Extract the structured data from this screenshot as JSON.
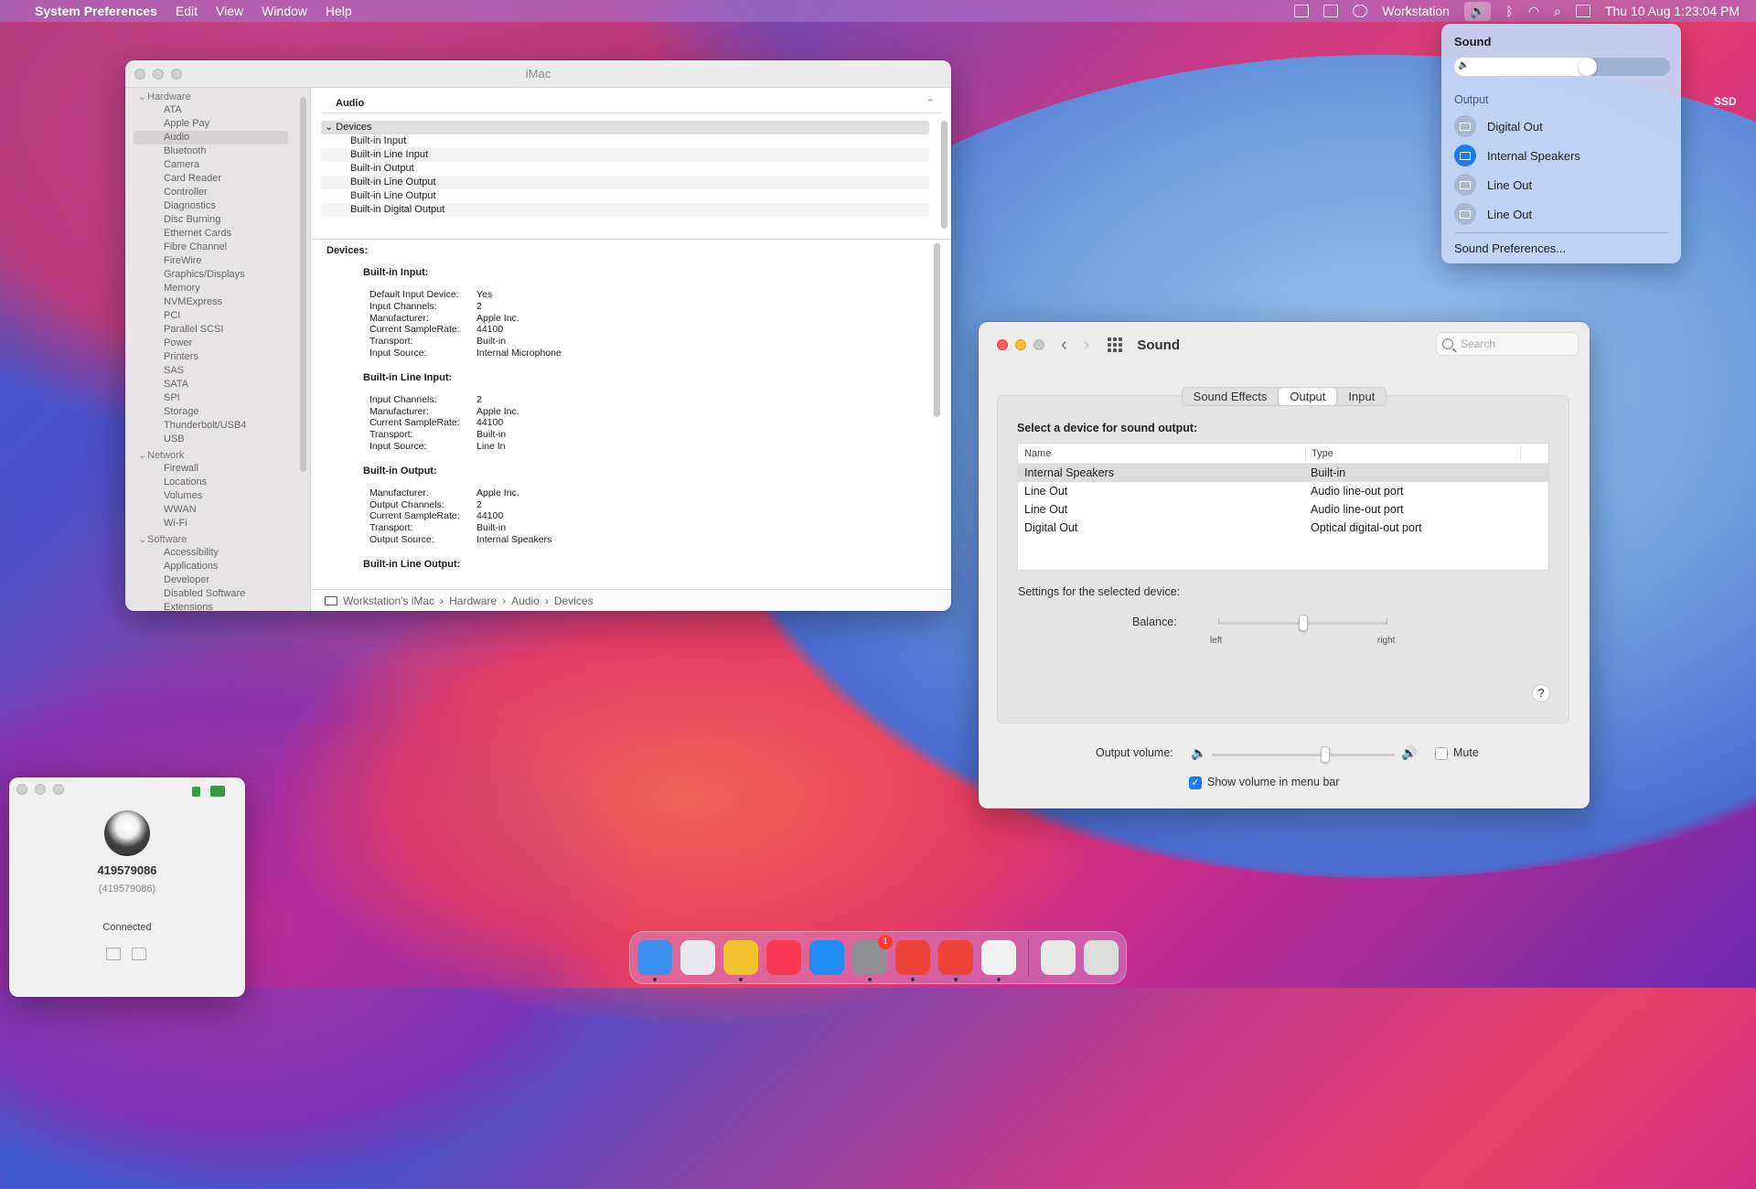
{
  "menubar": {
    "app_name": "System Preferences",
    "menus": [
      "Edit",
      "View",
      "Window",
      "Help"
    ],
    "user": "Workstation",
    "clock": "Thu 10 Aug  1:23:04 PM"
  },
  "desktop": {
    "disk_label": "SSD"
  },
  "sysinfo": {
    "title": "iMac",
    "sidebar": {
      "groups": [
        {
          "label": "Hardware",
          "items": [
            "ATA",
            "Apple Pay",
            "Audio",
            "Bluetooth",
            "Camera",
            "Card Reader",
            "Controller",
            "Diagnostics",
            "Disc Burning",
            "Ethernet Cards",
            "Fibre Channel",
            "FireWire",
            "Graphics/Displays",
            "Memory",
            "NVMExpress",
            "PCI",
            "Parallel SCSI",
            "Power",
            "Printers",
            "SAS",
            "SATA",
            "SPI",
            "Storage",
            "Thunderbolt/USB4",
            "USB"
          ]
        },
        {
          "label": "Network",
          "items": [
            "Firewall",
            "Locations",
            "Volumes",
            "WWAN",
            "Wi-Fi"
          ]
        },
        {
          "label": "Software",
          "items": [
            "Accessibility",
            "Applications",
            "Developer",
            "Disabled Software",
            "Extensions"
          ]
        }
      ],
      "selected": "Audio"
    },
    "section_title": "Audio",
    "tree": {
      "head": "Devices",
      "rows": [
        "Built-in Input",
        "Built-in Line Input",
        "Built-in Output",
        "Built-in Line Output",
        "Built-in Line Output",
        "Built-in Digital Output"
      ]
    },
    "details_title": "Devices:",
    "devices": [
      {
        "name": "Built-in Input:",
        "props": [
          [
            "Default Input Device:",
            "Yes"
          ],
          [
            "Input Channels:",
            "2"
          ],
          [
            "Manufacturer:",
            "Apple Inc."
          ],
          [
            "Current SampleRate:",
            "44100"
          ],
          [
            "Transport:",
            "Built-in"
          ],
          [
            "Input Source:",
            "Internal Microphone"
          ]
        ]
      },
      {
        "name": "Built-in Line Input:",
        "props": [
          [
            "Input Channels:",
            "2"
          ],
          [
            "Manufacturer:",
            "Apple Inc."
          ],
          [
            "Current SampleRate:",
            "44100"
          ],
          [
            "Transport:",
            "Built-in"
          ],
          [
            "Input Source:",
            "Line In"
          ]
        ]
      },
      {
        "name": "Built-in Output:",
        "props": [
          [
            "Manufacturer:",
            "Apple Inc."
          ],
          [
            "Output Channels:",
            "2"
          ],
          [
            "Current SampleRate:",
            "44100"
          ],
          [
            "Transport:",
            "Built-in"
          ],
          [
            "Output Source:",
            "Internal Speakers"
          ]
        ]
      },
      {
        "name": "Built-in Line Output:",
        "props": []
      }
    ],
    "path": [
      "Workstation's iMac",
      "Hardware",
      "Audio",
      "Devices"
    ]
  },
  "sound_prefs": {
    "title": "Sound",
    "search_placeholder": "Search",
    "tabs": [
      "Sound Effects",
      "Output",
      "Input"
    ],
    "selected_tab": "Output",
    "select_label": "Select a device for sound output:",
    "columns": [
      "Name",
      "Type"
    ],
    "devices": [
      {
        "name": "Internal Speakers",
        "type": "Built-in",
        "selected": true
      },
      {
        "name": "Line Out",
        "type": "Audio line-out port",
        "selected": false
      },
      {
        "name": "Line Out",
        "type": "Audio line-out port",
        "selected": false
      },
      {
        "name": "Digital Out",
        "type": "Optical digital-out port",
        "selected": false
      }
    ],
    "settings_label": "Settings for the selected device:",
    "balance_label": "Balance:",
    "balance_left": "left",
    "balance_right": "right",
    "balance_value": 0.5,
    "help_label": "?",
    "output_volume_label": "Output volume:",
    "output_volume": 0.62,
    "mute_label": "Mute",
    "mute_checked": false,
    "show_volume_label": "Show volume in menu bar",
    "show_volume_checked": true
  },
  "sound_menu": {
    "title": "Sound",
    "volume": 0.62,
    "output_label": "Output",
    "outputs": [
      {
        "name": "Digital Out",
        "active": false
      },
      {
        "name": "Internal Speakers",
        "active": true
      },
      {
        "name": "Line Out",
        "active": false
      },
      {
        "name": "Line Out",
        "active": false
      }
    ],
    "prefs_label": "Sound Preferences..."
  },
  "remote": {
    "id": "419579086",
    "sub": "(419579086)",
    "status": "Connected"
  },
  "dock": {
    "apps": [
      {
        "name": "finder-icon",
        "color": "#3d8ff0",
        "running": true
      },
      {
        "name": "launchpad-icon",
        "color": "#e8e8ee",
        "running": false
      },
      {
        "name": "chrome-icon",
        "color": "#f2c12e",
        "running": true
      },
      {
        "name": "music-icon",
        "color": "#fa3a55",
        "running": false
      },
      {
        "name": "app-store-icon",
        "color": "#1f8cf3",
        "running": false
      },
      {
        "name": "system-preferences-icon",
        "color": "#8e8e93",
        "running": true,
        "badge": "1"
      },
      {
        "name": "anydesk-icon",
        "color": "#ef443b",
        "running": true
      },
      {
        "name": "anydesk-alt-icon",
        "color": "#ef443b",
        "running": true
      },
      {
        "name": "system-information-icon",
        "color": "#f0f0f0",
        "running": true
      }
    ],
    "extras": [
      {
        "name": "document-icon",
        "color": "#e8e8e8"
      },
      {
        "name": "trash-icon",
        "color": "#dcdcdc"
      }
    ]
  }
}
